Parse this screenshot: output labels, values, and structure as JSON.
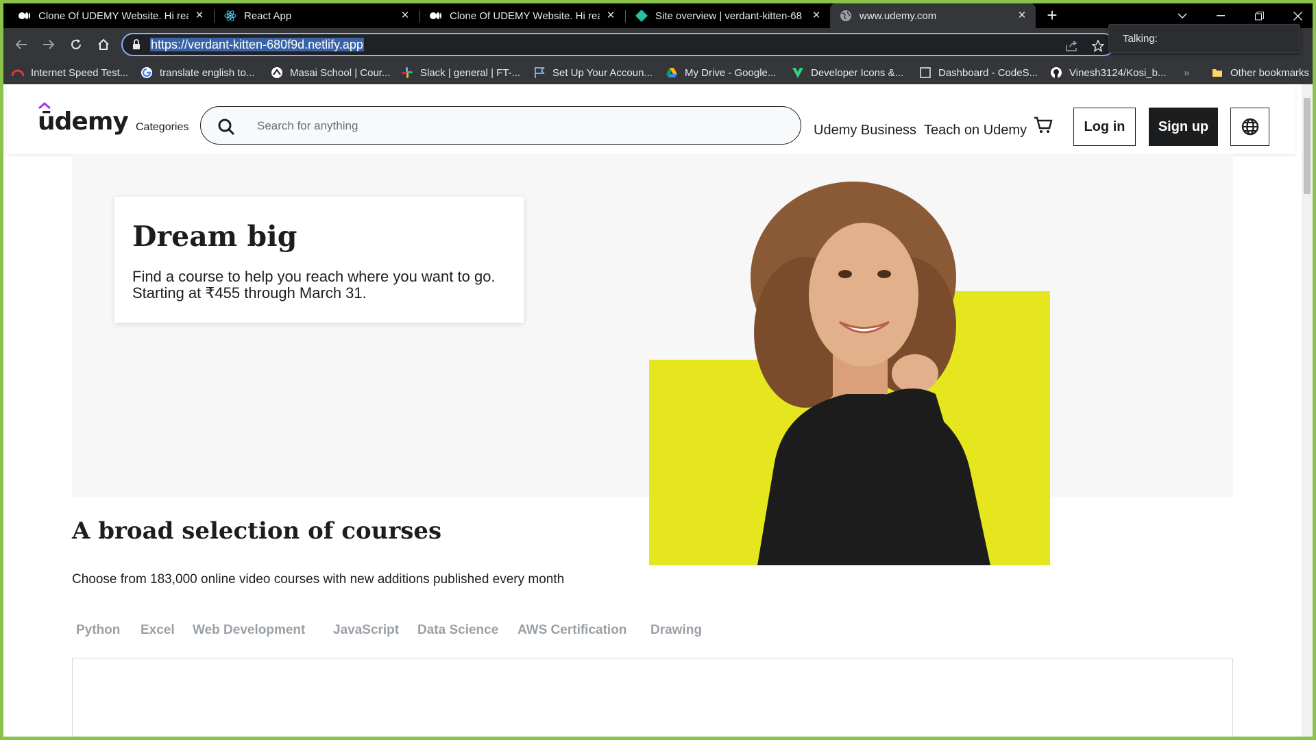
{
  "browser": {
    "tabs": [
      {
        "title": "Clone Of UDEMY Website. Hi rea",
        "icon": "medium-icon",
        "active": false
      },
      {
        "title": "React App",
        "icon": "react-icon",
        "active": false
      },
      {
        "title": "Clone Of UDEMY Website. Hi rea",
        "icon": "medium-icon",
        "active": false
      },
      {
        "title": "Site overview | verdant-kitten-68",
        "icon": "netlify-icon",
        "active": false
      },
      {
        "title": "www.udemy.com",
        "icon": "globe-icon",
        "active": true
      }
    ],
    "address_bar": {
      "url": "https://verdant-kitten-680f9d.netlify.app"
    },
    "tooltip": "Talking:",
    "bookmarks": [
      {
        "label": "Internet Speed Test...",
        "icon": "speedtest-icon"
      },
      {
        "label": "translate english to...",
        "icon": "google-icon"
      },
      {
        "label": "Masai School | Cour...",
        "icon": "masai-icon"
      },
      {
        "label": "Slack | general | FT-...",
        "icon": "slack-icon"
      },
      {
        "label": "Set Up Your Accoun...",
        "icon": "flag-icon"
      },
      {
        "label": "My Drive - Google...",
        "icon": "drive-icon"
      },
      {
        "label": "Developer Icons &...",
        "icon": "devicons-icon"
      },
      {
        "label": "Dashboard - CodeS...",
        "icon": "page-icon"
      },
      {
        "label": "Vinesh3124/Kosi_b...",
        "icon": "github-icon"
      }
    ],
    "other_bookmarks": "Other bookmarks",
    "overflow": "»"
  },
  "header": {
    "logo": "ūdemy",
    "categories": "Categories",
    "search_placeholder": "Search for anything",
    "business_link": "Udemy Business",
    "teach_link": "Teach on Udemy",
    "login": "Log in",
    "signup": "Sign up"
  },
  "hero": {
    "title": "Dream big",
    "line1": "Find a course to help you reach where you want to go.",
    "line2": "Starting at ₹455 through March 31.",
    "accent_color": "#e6e61f"
  },
  "courses": {
    "title": "A broad selection of courses",
    "subtitle": "Choose from 183,000 online video courses with new additions published every month",
    "tabs": [
      "Python",
      "Excel",
      "Web Development",
      "JavaScript",
      "Data Science",
      "AWS Certification",
      "Drawing"
    ]
  }
}
